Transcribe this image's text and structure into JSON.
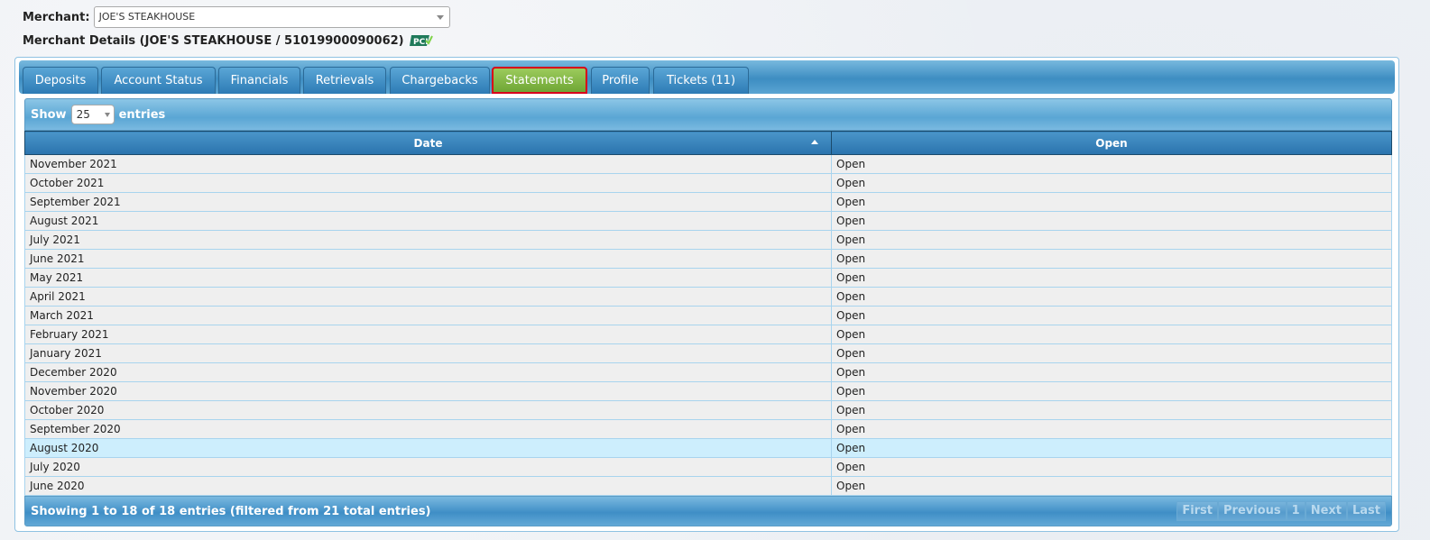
{
  "merchant": {
    "label": "Merchant:",
    "selected": "JOE'S STEAKHOUSE"
  },
  "details": {
    "title": "Merchant Details (JOE'S STEAKHOUSE / 51019900090062)",
    "badge_icon": "pci-icon"
  },
  "tabs": [
    {
      "label": "Deposits"
    },
    {
      "label": "Account Status"
    },
    {
      "label": "Financials"
    },
    {
      "label": "Retrievals"
    },
    {
      "label": "Chargebacks"
    },
    {
      "label": "Statements",
      "active": true
    },
    {
      "label": "Profile"
    },
    {
      "label": "Tickets (11)"
    }
  ],
  "table": {
    "show_label": "Show",
    "entries_label": "entries",
    "page_length": "25",
    "headers": {
      "date": "Date",
      "open": "Open"
    },
    "rows": [
      {
        "date": "November 2021",
        "open": "Open"
      },
      {
        "date": "October 2021",
        "open": "Open"
      },
      {
        "date": "September 2021",
        "open": "Open"
      },
      {
        "date": "August 2021",
        "open": "Open"
      },
      {
        "date": "July 2021",
        "open": "Open"
      },
      {
        "date": "June 2021",
        "open": "Open"
      },
      {
        "date": "May 2021",
        "open": "Open"
      },
      {
        "date": "April 2021",
        "open": "Open"
      },
      {
        "date": "March 2021",
        "open": "Open"
      },
      {
        "date": "February 2021",
        "open": "Open"
      },
      {
        "date": "January 2021",
        "open": "Open"
      },
      {
        "date": "December 2020",
        "open": "Open"
      },
      {
        "date": "November 2020",
        "open": "Open"
      },
      {
        "date": "October 2020",
        "open": "Open"
      },
      {
        "date": "September 2020",
        "open": "Open"
      },
      {
        "date": "August 2020",
        "open": "Open",
        "highlighted": true
      },
      {
        "date": "July 2020",
        "open": "Open"
      },
      {
        "date": "June 2020",
        "open": "Open"
      }
    ],
    "info": "Showing 1 to 18 of 18 entries (filtered from 21 total entries)",
    "pager": {
      "first": "First",
      "previous": "Previous",
      "page": "1",
      "next": "Next",
      "last": "Last"
    }
  }
}
